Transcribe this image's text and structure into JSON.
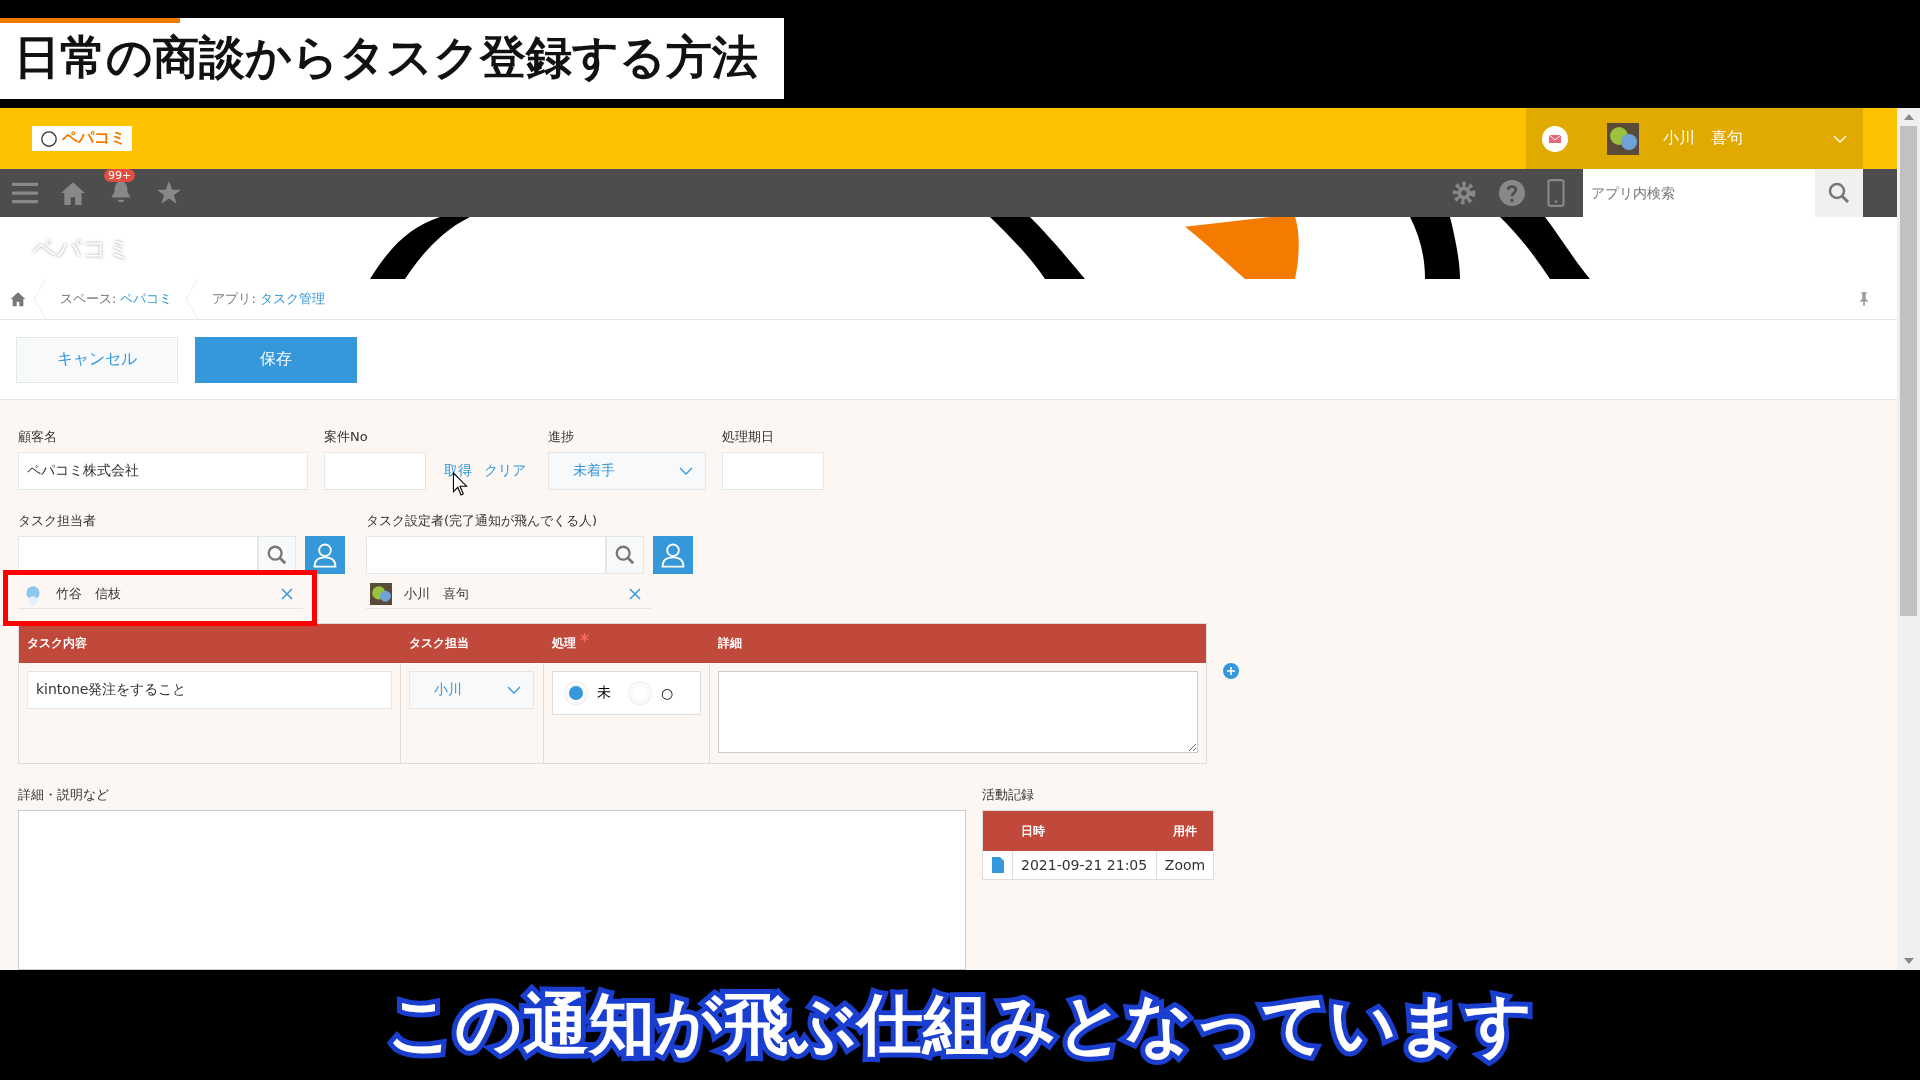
{
  "title_caption": "日常の商談からタスク登録する方法",
  "header": {
    "logo": "ペパコミ",
    "user_name": "小川　喜句"
  },
  "nav": {
    "badge": "99+",
    "search": {
      "placeholder": "アプリ内検索"
    }
  },
  "banner": {
    "space_name": "ペパコミ"
  },
  "breadcrumb": [
    {
      "label": "スペース: ",
      "link": "ペパコミ"
    },
    {
      "label": "アプリ: ",
      "link": "タスク管理"
    }
  ],
  "buttons": {
    "cancel": "キャンセル",
    "save": "保存"
  },
  "fields": {
    "customer": {
      "label": "顧客名",
      "value": "ペパコミ株式会社"
    },
    "case_no": {
      "label": "案件No",
      "links": [
        "取得",
        "クリア"
      ]
    },
    "progress": {
      "label": "進捗",
      "value": "未着手"
    },
    "due": {
      "label": "処理期日"
    }
  },
  "assignee": {
    "label": "タスク担当者",
    "highlighted": true,
    "users": [
      {
        "name": "竹谷　信枝"
      }
    ]
  },
  "setter": {
    "label": "タスク設定者(完了通知が飛んでくる人)",
    "users": [
      {
        "name": "小川　喜句"
      }
    ]
  },
  "task_table": {
    "columns": [
      {
        "label": "タスク内容",
        "required": false
      },
      {
        "label": "タスク担当",
        "required": false
      },
      {
        "label": "処理",
        "required": true
      },
      {
        "label": "詳細",
        "required": false
      }
    ],
    "rows": [
      {
        "content": "kintone発注をすること",
        "assignee": "小川",
        "status_options": [
          {
            "label": "未",
            "selected": true
          },
          {
            "label": "○",
            "selected": false
          }
        ]
      }
    ]
  },
  "notes": {
    "label": "詳細・説明など"
  },
  "activity": {
    "label": "活動記録",
    "columns": [
      "日時",
      "用件"
    ],
    "rows": [
      {
        "datetime": "2021-09-21 21:05",
        "subject": "Zoom"
      }
    ]
  },
  "subtitle": "この通知が飛ぶ仕組みとなっています"
}
